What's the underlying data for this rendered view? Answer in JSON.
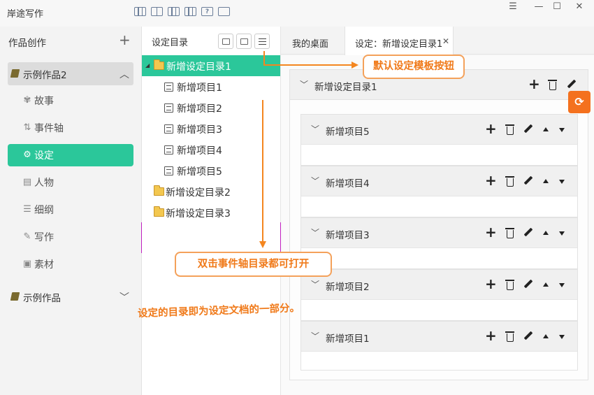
{
  "app": {
    "title": "岸途写作"
  },
  "window": {
    "minimize": "☰",
    "restore": "—",
    "maximize": "☐",
    "close": "✕"
  },
  "sidebar": {
    "header": "作品创作",
    "add": "+",
    "book1": {
      "label": "示例作品2",
      "chevron": "︿"
    },
    "items": [
      {
        "label": "故事",
        "icon": "✾"
      },
      {
        "label": "事件轴",
        "icon": "⇅"
      },
      {
        "label": "设定",
        "icon": "⚙"
      },
      {
        "label": "人物",
        "icon": "▤"
      },
      {
        "label": "细纲",
        "icon": "☰"
      },
      {
        "label": "写作",
        "icon": "✎"
      },
      {
        "label": "素材",
        "icon": "▣"
      }
    ],
    "book2": {
      "label": "示例作品",
      "chevron": "﹀"
    }
  },
  "tree": {
    "title": "设定目录",
    "nodes": [
      {
        "label": "新增设定目录1",
        "type": "folder",
        "expanded": true
      },
      {
        "label": "新增项目1",
        "type": "doc"
      },
      {
        "label": "新增项目2",
        "type": "doc"
      },
      {
        "label": "新增项目3",
        "type": "doc"
      },
      {
        "label": "新增项目4",
        "type": "doc"
      },
      {
        "label": "新增项目5",
        "type": "doc"
      },
      {
        "label": "新增设定目录2",
        "type": "folder"
      },
      {
        "label": "新增设定目录3",
        "type": "folder"
      }
    ]
  },
  "tabs": [
    {
      "label": "我的桌面"
    },
    {
      "label": "设定：新增设定目录1",
      "active": true,
      "close": "✕"
    }
  ],
  "editor": {
    "outer": {
      "title": "新增设定目录1",
      "add": "+"
    },
    "items": [
      {
        "title": "新增项目5"
      },
      {
        "title": "新增项目4"
      },
      {
        "title": "新增项目3"
      },
      {
        "title": "新增项目2"
      },
      {
        "title": "新增项目1"
      }
    ],
    "chevron": "﹀",
    "add": "+"
  },
  "refresh": "⟳",
  "annotations": {
    "default_template": "默认设定模板按钮",
    "double_click": "双击事件轴目录都可打开",
    "note": "设定的目录即为设定文档的一部分。"
  },
  "colors": {
    "accent": "#2bc79a",
    "annotation": "#f07a1a",
    "refresh": "#f4711e"
  }
}
